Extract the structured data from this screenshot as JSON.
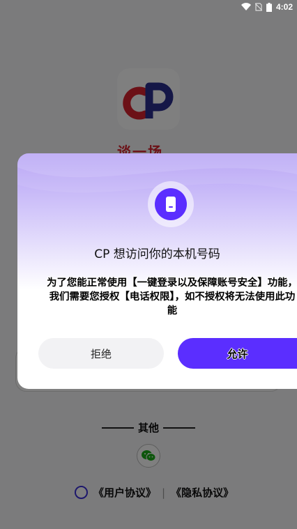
{
  "status_bar": {
    "time": "4:02",
    "icons": [
      "wifi-icon",
      "no-sim-icon",
      "battery-icon"
    ]
  },
  "background_app": {
    "slogan": "谈一场，",
    "other_label": "其他",
    "agreement": {
      "user_agreement": "《用户协议》",
      "separator": "|",
      "privacy_agreement": "《隐私协议》"
    },
    "colors": {
      "brand_red": "#d9232e",
      "brand_navy": "#2b2f8f"
    }
  },
  "dialog": {
    "title": "CP 想访问你的本机号码",
    "message": "为了您能正常使用【一键登录以及保障账号安全】功能，我们需要您授权【电话权限】，如不授权将无法使用此功能",
    "deny_label": "拒绝",
    "allow_label": "允许",
    "icon": "phone-icon",
    "accent_color": "#5b2eff"
  }
}
